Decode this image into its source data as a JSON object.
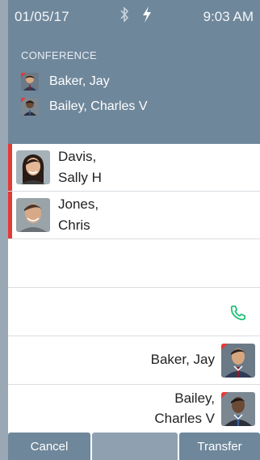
{
  "status": {
    "date": "01/05/17",
    "time": "9:03 AM"
  },
  "conference": {
    "title": "CONFERENCE",
    "participants": [
      {
        "name": "Baker, Jay"
      },
      {
        "name": "Bailey, Charles V"
      }
    ]
  },
  "calls": [
    {
      "line1": "Davis,",
      "line2": "Sally H"
    },
    {
      "line1": "Jones,",
      "line2": "Chris"
    }
  ],
  "incoming": [
    {
      "line1": "Baker, Jay"
    },
    {
      "line1": "Bailey,",
      "line2": "Charles V"
    }
  ],
  "buttons": {
    "cancel": "Cancel",
    "middle": "",
    "transfer": "Transfer"
  },
  "colors": {
    "panel": "#6f879b",
    "accent_red": "#e53935",
    "phone_green": "#27c27a"
  }
}
